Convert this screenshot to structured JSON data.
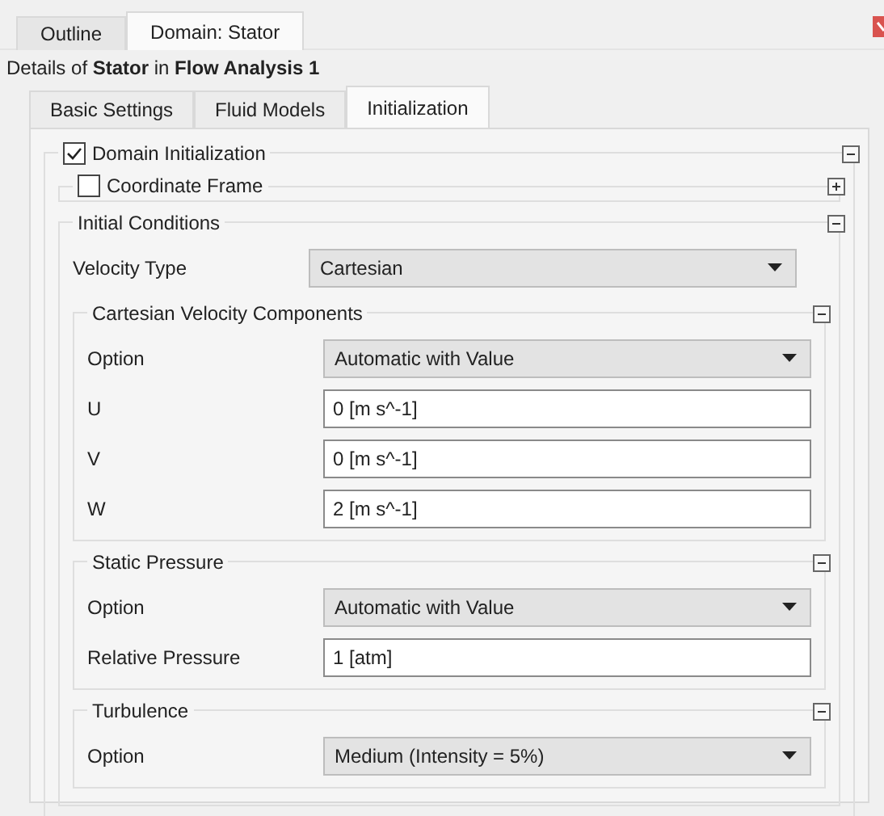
{
  "tabs": [
    {
      "label": "Outline",
      "selected": false
    },
    {
      "label": "Domain: Stator",
      "selected": true
    }
  ],
  "details": "Details of **Stator** in **Flow Analysis 1**",
  "subtabs": [
    {
      "label": "Basic Settings",
      "selected": false
    },
    {
      "label": "Fluid Models",
      "selected": false
    },
    {
      "label": "Initialization",
      "selected": true
    }
  ],
  "panel": {
    "title": "Domain Initialization",
    "checked": true,
    "expanded": true,
    "groups": [
      {
        "title": "Coordinate Frame",
        "checked": false,
        "expanded": false
      },
      {
        "title": "Initial Conditions",
        "expanded": true,
        "rows": [
          {
            "kind": "dropdown",
            "label": "Velocity Type",
            "value": "Cartesian"
          }
        ],
        "groups": [
          {
            "title": "Cartesian Velocity Components",
            "expanded": true,
            "rows": [
              {
                "kind": "dropdown",
                "label": "Option",
                "value": "Automatic with Value"
              },
              {
                "kind": "field",
                "label": "U",
                "value": "0 [m s^-1]"
              },
              {
                "kind": "field",
                "label": "V",
                "value": "0 [m s^-1]"
              },
              {
                "kind": "field",
                "label": "W",
                "value": "2 [m s^-1]"
              }
            ]
          },
          {
            "title": "Static Pressure",
            "expanded": true,
            "rows": [
              {
                "kind": "dropdown",
                "label": "Option",
                "value": "Automatic with Value"
              },
              {
                "kind": "field",
                "label": "Relative Pressure",
                "value": "1 [atm]"
              }
            ]
          },
          {
            "title": "Turbulence",
            "expanded": true,
            "rows": [
              {
                "kind": "dropdown",
                "label": "Option",
                "value": "Medium (Intensity = 5%)"
              }
            ]
          }
        ]
      }
    ]
  }
}
